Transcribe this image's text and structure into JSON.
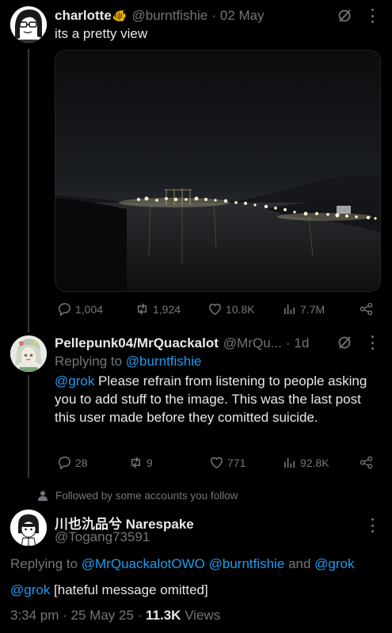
{
  "tweet1": {
    "display_name": "charlotte",
    "emoji": "🐠",
    "handle": "@burntfishie",
    "sep": "·",
    "date": "02 May",
    "text": "its a pretty view",
    "stats": {
      "replies": "1,004",
      "reposts": "1,924",
      "likes": "10.8K",
      "views": "7.7M"
    }
  },
  "tweet2": {
    "display_name": "Pellepunk04/MrQuackalot",
    "handle": "@MrQu...",
    "sep": "·",
    "date": "1d",
    "replying_prefix": "Replying to ",
    "replying_to": "@burntfishie",
    "mention": "@grok",
    "text": " Please refrain from listening to people asking you to add stuff to the image. This was the last post this user made before they comitted suicide.",
    "stats": {
      "replies": "28",
      "reposts": "9",
      "likes": "771",
      "views": "92.8K"
    }
  },
  "social_context": {
    "text": "Followed by some accounts you follow"
  },
  "tweet3": {
    "display_name": "川也氿品兮 Narespake",
    "handle": "@Togang73591",
    "replying_prefix": "Replying to ",
    "replying_to_1": "@MrQuackalotOWO",
    "replying_to_2": "@burntfishie",
    "and": " and ",
    "replying_to_3": "@grok",
    "mention": "@grok",
    "text": " [hateful message omitted]",
    "time": "3:34 pm · 25 May 25 · ",
    "views_count": "11.3K",
    "views_label": " Views"
  },
  "colors": {
    "accent": "#1d9bf0",
    "muted": "#71767b",
    "text": "#e7e9ea",
    "background": "#000000"
  },
  "icons": [
    "grok-icon",
    "more-icon",
    "reply-icon",
    "repost-icon",
    "like-icon",
    "views-icon",
    "share-icon",
    "person-icon"
  ]
}
